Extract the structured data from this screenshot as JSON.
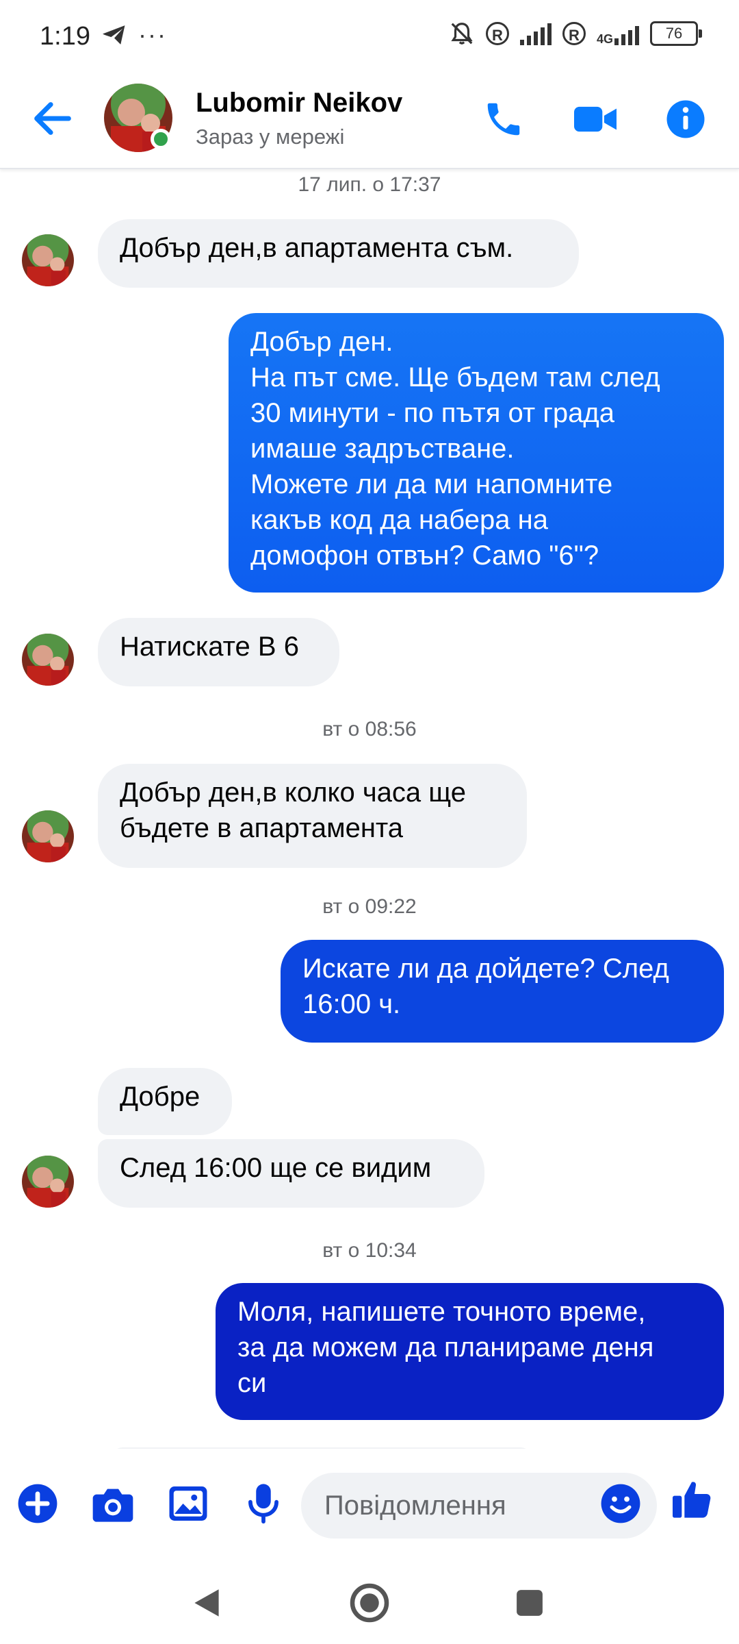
{
  "status_bar": {
    "time": "1:19",
    "network_label": "4G",
    "battery": "76"
  },
  "header": {
    "contact_name": "Lubomir Neikov",
    "presence": "Зараз у мережі",
    "accent_color": "#0a7cff",
    "online_color": "#31a24c"
  },
  "chat": {
    "messages": [
      {
        "type": "timestamp",
        "text": "17 лип. о 17:37"
      },
      {
        "type": "incoming",
        "text": "Добър ден,в апартамента съм."
      },
      {
        "type": "outgoing",
        "lines": [
          "Добър ден.",
          "На път сме. Ще бъдем там след",
          "30 минути - по пътя от града",
          "имаше задръстване.",
          "Можете ли да ми напомните",
          "какъв код да набера на",
          "домофон отвън? Само \"6\"?"
        ]
      },
      {
        "type": "incoming",
        "text": "Натискате В 6"
      },
      {
        "type": "timestamp",
        "text": "вт о 08:56"
      },
      {
        "type": "incoming",
        "lines": [
          "Добър ден,в колко часа ще",
          "бъдете в апартамента"
        ]
      },
      {
        "type": "timestamp",
        "text": "вт о 09:22"
      },
      {
        "type": "outgoing",
        "lines": [
          "Искате ли да дойдете? След",
          "16:00 ч."
        ]
      },
      {
        "type": "incoming",
        "text": "Добре"
      },
      {
        "type": "incoming",
        "text": "След 16:00 ще се видим"
      },
      {
        "type": "timestamp",
        "text": "вт о 10:34"
      },
      {
        "type": "outgoing",
        "lines": [
          "Моля, напишете точното време,",
          "за да можем да планираме деня",
          "си"
        ]
      }
    ]
  },
  "composer": {
    "placeholder": "Повідомлення"
  },
  "icons": {
    "back": "arrow-left-icon",
    "call": "phone-icon",
    "video": "video-camera-icon",
    "info": "info-icon",
    "add": "plus-icon",
    "camera": "camera-icon",
    "gallery": "image-icon",
    "mic": "microphone-icon",
    "emoji": "smiley-icon",
    "like": "thumbs-up-icon"
  }
}
